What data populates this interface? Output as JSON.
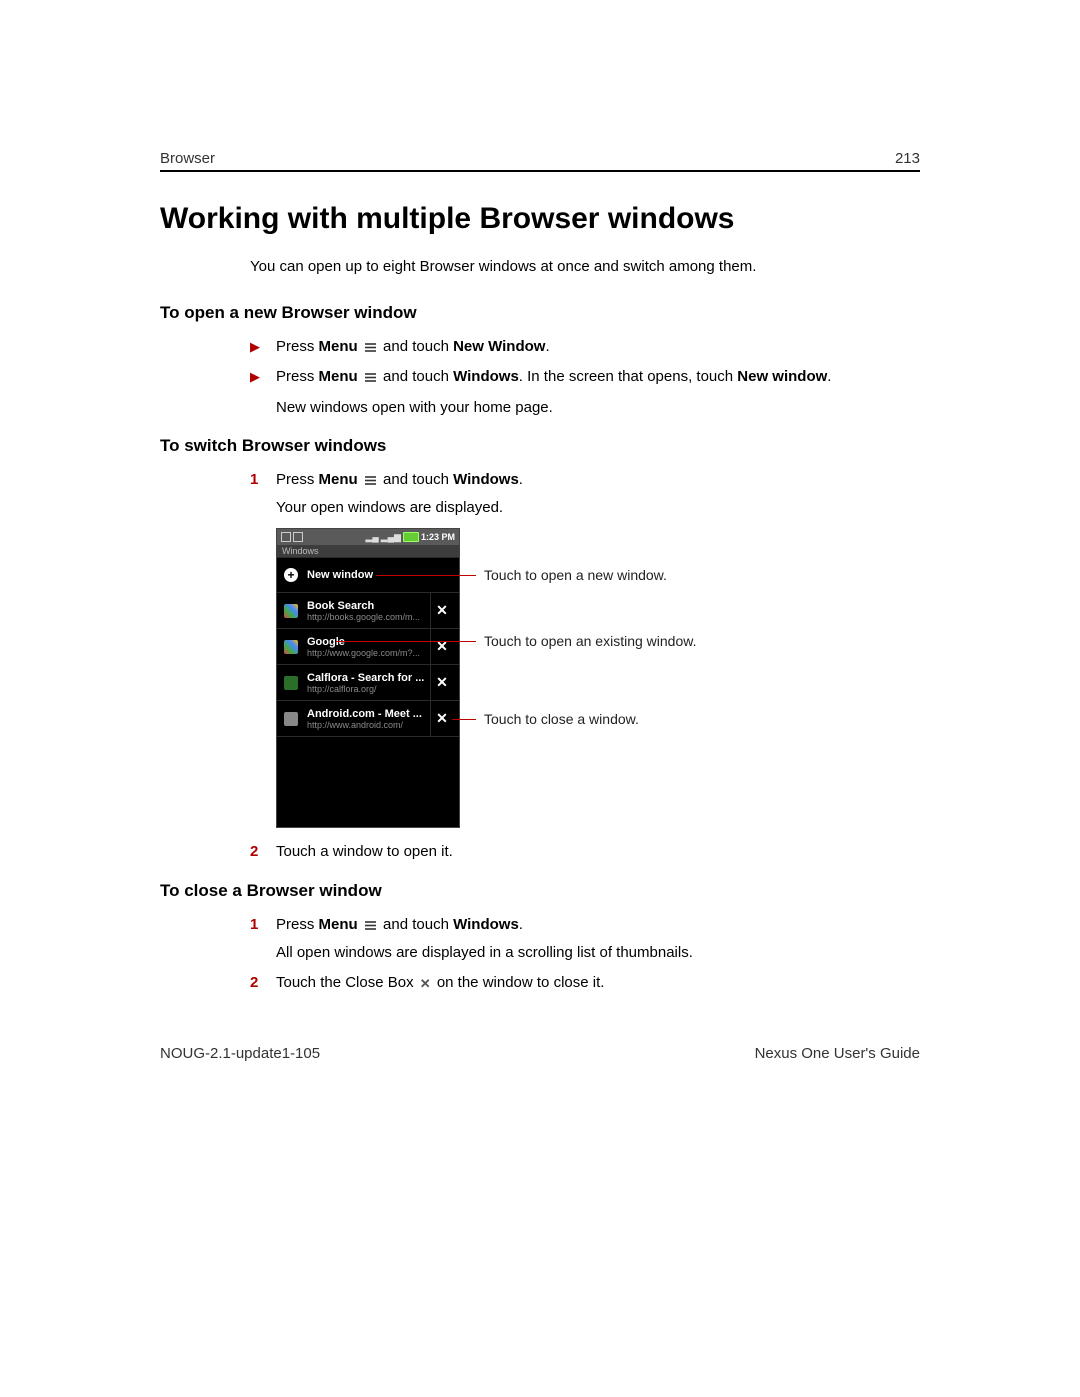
{
  "header": {
    "section": "Browser",
    "page": "213"
  },
  "title": "Working with multiple Browser windows",
  "intro": "You can open up to eight Browser windows at once and switch among them.",
  "section_open": {
    "heading": "To open a new Browser window",
    "item1_pre": "Press ",
    "item1_menu": "Menu",
    "item1_mid": " and touch ",
    "item1_bold": "New Window",
    "item1_post": ".",
    "item2_pre": "Press ",
    "item2_menu": "Menu",
    "item2_mid": " and touch ",
    "item2_bold": "Windows",
    "item2_post1": ". In the screen that opens, touch ",
    "item2_bold2": "New window",
    "item2_post2": ".",
    "note": "New windows open with your home page."
  },
  "section_switch": {
    "heading": "To switch Browser windows",
    "step1_pre": "Press ",
    "step1_menu": "Menu",
    "step1_mid": " and touch ",
    "step1_bold": "Windows",
    "step1_post": ".",
    "step1_sub": "Your open windows are displayed.",
    "step2": "Touch a window to open it."
  },
  "section_close": {
    "heading": "To close a Browser window",
    "step1_pre": "Press ",
    "step1_menu": "Menu",
    "step1_mid": " and touch ",
    "step1_bold": "Windows",
    "step1_post": ".",
    "step1_sub": "All open windows are displayed in a scrolling list of thumbnails.",
    "step2_pre": "Touch the Close Box ",
    "step2_post": " on the window to close it."
  },
  "phone": {
    "time": "1:23 PM",
    "windows_label": "Windows",
    "new_window": "New window",
    "items": [
      {
        "title": "Book Search",
        "url": "http://books.google.com/m..."
      },
      {
        "title": "Google",
        "url": "http://www.google.com/m?..."
      },
      {
        "title": "Calflora - Search for ...",
        "url": "http://calflora.org/"
      },
      {
        "title": "Android.com - Meet ...",
        "url": "http://www.android.com/"
      }
    ]
  },
  "callouts": {
    "c1": "Touch to open a new window.",
    "c2": "Touch to open an existing window.",
    "c3": "Touch to close a window."
  },
  "footer": {
    "left": "NOUG-2.1-update1-105",
    "right": "Nexus One User's Guide"
  },
  "nums": {
    "n1": "1",
    "n2": "2"
  }
}
